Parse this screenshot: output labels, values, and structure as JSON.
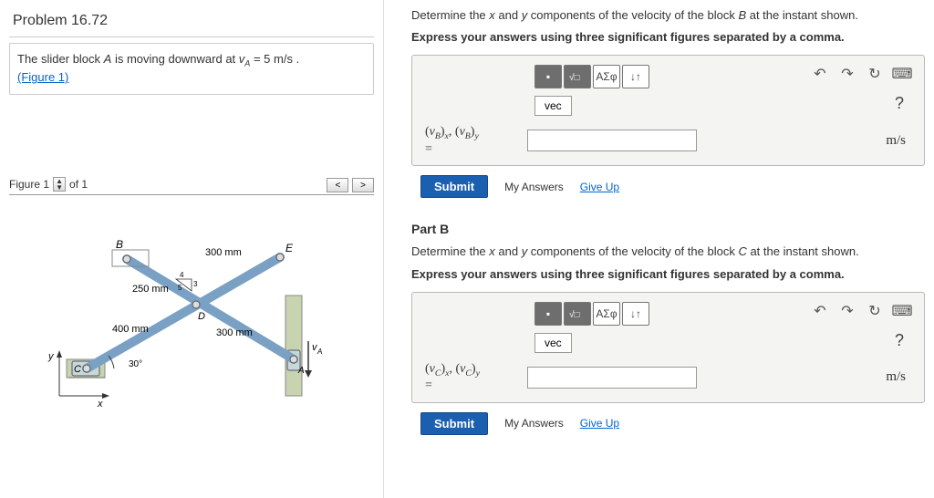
{
  "problem": {
    "title": "Problem 16.72",
    "desc_prefix": "The slider block ",
    "desc_var": "A",
    "desc_mid": " is moving downward at ",
    "desc_eq": "v",
    "desc_sub": "A",
    "desc_val": " = 5  m/s",
    "desc_end": " .",
    "figure_link": "(Figure 1)"
  },
  "figure_nav": {
    "label": "Figure 1",
    "of_text": "of 1",
    "prev": "<",
    "next": ">"
  },
  "figure": {
    "B": "B",
    "E": "E",
    "C": "C",
    "D": "D",
    "A": "A",
    "vA": "v",
    "vA_sub": "A",
    "d300a": "300 mm",
    "d250": "250 mm",
    "d400": "400 mm",
    "d300b": "300 mm",
    "ang": "30°",
    "n3": "3",
    "n4": "4",
    "n5": "5",
    "x": "x",
    "y": "y"
  },
  "partA": {
    "instruction_pre": "Determine the ",
    "x": "x",
    "and": " and ",
    "y": "y",
    "instruction_post": " components of the velocity of the block ",
    "block": "B",
    "instruction_end": " at the instant shown.",
    "express": "Express your answers using three significant figures separated by a comma.",
    "vec": "vec",
    "eq_label_html": "(vB)x, (vB)y",
    "unit": "m/s",
    "submit": "Submit",
    "my_answers": "My Answers",
    "give_up": "Give Up"
  },
  "partB": {
    "title": "Part B",
    "instruction_pre": "Determine the ",
    "x": "x",
    "and": " and ",
    "y": "y",
    "instruction_post": " components of the velocity of the block ",
    "block": "C",
    "instruction_end": " at the instant shown.",
    "express": "Express your answers using three significant figures separated by a comma.",
    "vec": "vec",
    "unit": "m/s",
    "submit": "Submit",
    "my_answers": "My Answers",
    "give_up": "Give Up"
  },
  "toolbar": {
    "greek": "ΑΣφ",
    "arrows": "↓↑",
    "undo": "↶",
    "redo": "↷",
    "reset": "↻",
    "keyboard": "⌨",
    "help": "?"
  }
}
